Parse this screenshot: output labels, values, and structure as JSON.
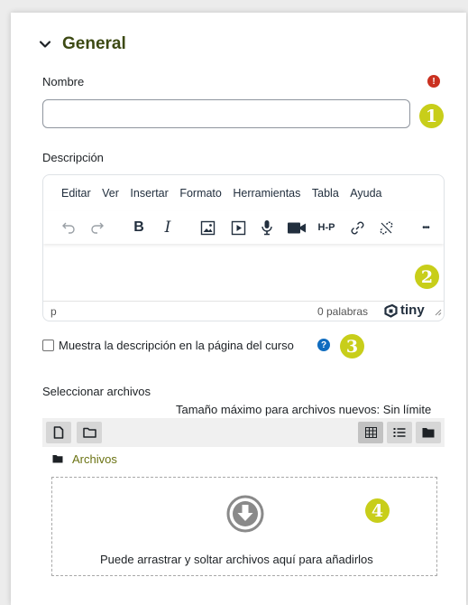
{
  "section": {
    "title": "General"
  },
  "name_field": {
    "label": "Nombre",
    "value": "",
    "required_icon": "exclamation-circle-icon"
  },
  "description": {
    "label": "Descripción",
    "menu": [
      "Editar",
      "Ver",
      "Insertar",
      "Formato",
      "Herramientas",
      "Tabla",
      "Ayuda"
    ],
    "toolbar_icons": [
      "undo-icon",
      "redo-icon",
      "bold-icon",
      "italic-icon",
      "image-icon",
      "media-icon",
      "microphone-icon",
      "video-camera-icon",
      "h5p-icon",
      "link-icon",
      "unlink-icon",
      "more-icon"
    ],
    "bold_glyph": "B",
    "italic_glyph": "I",
    "h5p_glyph": "H-P",
    "more_glyph": "•••",
    "status_path": "p",
    "word_count": "0 palabras",
    "brand": "tiny"
  },
  "show_description": {
    "label": "Muestra la descripción en la página del curso",
    "checked": false
  },
  "files": {
    "label": "Seleccionar archivos",
    "max_size": "Tamaño máximo para archivos nuevos: Sin límite",
    "folder_label": "Archivos",
    "drop_text": "Puede arrastrar y soltar archivos aquí para añadirlos"
  },
  "markers": [
    "1",
    "2",
    "3",
    "4"
  ],
  "colors": {
    "section_title": "#3d4a14",
    "marker": "#c8ce1a",
    "required": "#ca3120",
    "help": "#0f6cbf",
    "link": "#6b7313"
  }
}
